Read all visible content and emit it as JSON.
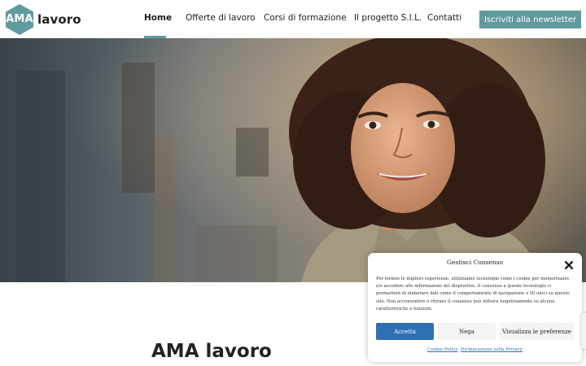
{
  "brand": {
    "logo_mark": "AMA",
    "logo_word": "lavoro",
    "accent": "#5f9a9e"
  },
  "nav": {
    "items": [
      {
        "label": "Home",
        "active": true
      },
      {
        "label": "Offerte di lavoro",
        "active": false
      },
      {
        "label": "Corsi di formazione",
        "active": false
      },
      {
        "label": "Il progetto S.I.L.",
        "active": false
      },
      {
        "label": "Contatti",
        "active": false
      }
    ],
    "newsletter_label": "Iscriviti alla newsletter"
  },
  "hero": {
    "image": "smiling-woman-curly-hair-photo"
  },
  "main": {
    "title": "AMA lavoro"
  },
  "consent": {
    "title": "Gestisci Consenso",
    "text": "Per fornire le migliori esperienze, utilizziamo tecnologie come i cookie per memorizzare e/o accedere alle informazioni del dispositivo. Il consenso a queste tecnologie ci permetterà di elaborare dati come il comportamento di navigazione o ID unici su questo sito. Non acconsentire o ritirare il consenso può influire negativamente su alcune caratteristiche e funzioni.",
    "accept_label": "Accetta",
    "deny_label": "Nega",
    "prefs_label": "Visualizza le preferenze",
    "cookie_policy_label": "Cookie Policy",
    "privacy_label": "Dichiarazione sulla Privacy",
    "accept_color": "#2f6fb6"
  }
}
